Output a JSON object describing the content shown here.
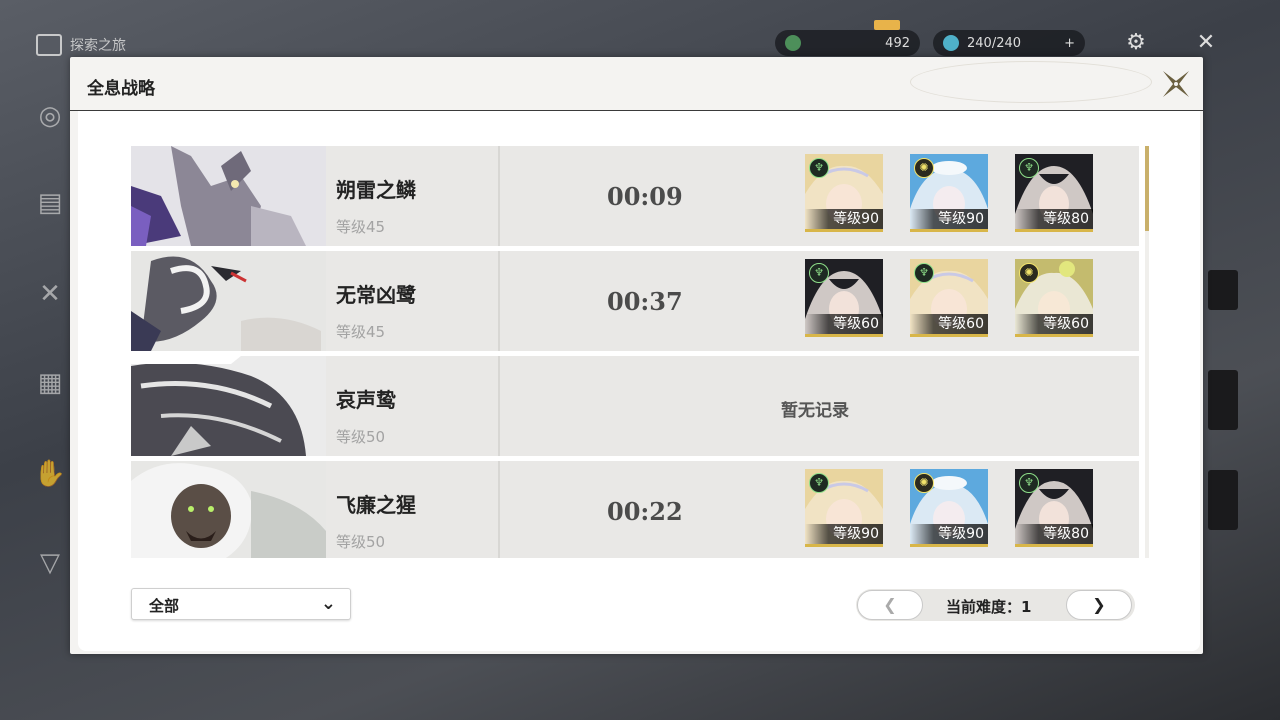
{
  "background": {
    "breadcrumb": "探索之旅",
    "resource1": "492",
    "resource2": "240/240"
  },
  "modal": {
    "title": "全息战略"
  },
  "bosses": [
    {
      "name": "朔雷之鳞",
      "level": "等级45",
      "time": "00:09",
      "team": [
        {
          "element": "aero",
          "level": "等级90"
        },
        {
          "element": "light",
          "level": "等级90"
        },
        {
          "element": "aero",
          "level": "等级80"
        }
      ]
    },
    {
      "name": "无常凶鹭",
      "level": "等级45",
      "time": "00:37",
      "team": [
        {
          "element": "aero",
          "level": "等级60"
        },
        {
          "element": "aero",
          "level": "等级60"
        },
        {
          "element": "light",
          "level": "等级60"
        }
      ]
    },
    {
      "name": "哀声鸷",
      "level": "等级50",
      "no_record": "暂无记录"
    },
    {
      "name": "飞廉之猩",
      "level": "等级50",
      "time": "00:22",
      "team": [
        {
          "element": "aero",
          "level": "等级90"
        },
        {
          "element": "light",
          "level": "等级90"
        },
        {
          "element": "aero",
          "level": "等级80"
        }
      ]
    }
  ],
  "filter": {
    "selected": "全部",
    "chevron": "⌄"
  },
  "pager": {
    "prev": "❮",
    "next": "❯",
    "label": "当前难度：1"
  },
  "colors": {
    "accent_gold": "#d8b649",
    "aero": "#8fe08a",
    "light": "#f2e36b"
  }
}
